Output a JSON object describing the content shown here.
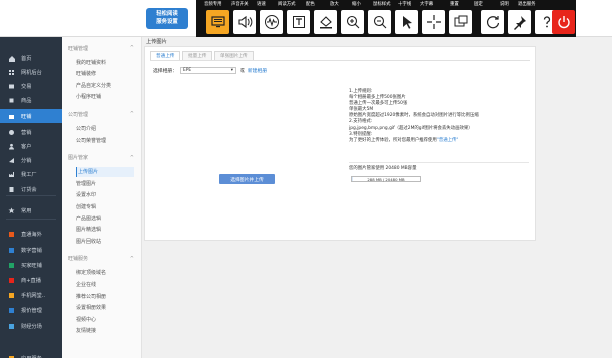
{
  "toolbar": {
    "brand": {
      "line1": "轻松阅读",
      "line2": "服务设置"
    },
    "labels": [
      "音频专用",
      "声音开关",
      "语速",
      "阅读方式",
      "配色",
      "放大",
      "缩小",
      "鼠标样式",
      "十字线",
      "大字幕",
      "重置",
      "固定",
      "说明",
      "退出服务"
    ],
    "buttons": [
      {
        "name": "screen-reader-button",
        "icon": "monitor-icon"
      },
      {
        "name": "sound-toggle-button",
        "icon": "speaker-icon"
      },
      {
        "name": "speed-button",
        "icon": "waveform-icon"
      },
      {
        "name": "read-mode-button",
        "icon": "read-mode-icon"
      },
      {
        "name": "color-scheme-button",
        "icon": "paint-bucket-icon"
      },
      {
        "name": "zoom-in-button",
        "icon": "zoom-in-icon"
      },
      {
        "name": "zoom-out-button",
        "icon": "zoom-out-icon"
      },
      {
        "name": "cursor-style-button",
        "icon": "cursor-icon"
      },
      {
        "name": "crosshair-button",
        "icon": "crosshair-icon"
      },
      {
        "name": "large-caption-button",
        "icon": "caption-icon"
      },
      {
        "name": "reset-button",
        "icon": "reset-icon"
      },
      {
        "name": "pin-button",
        "icon": "pin-icon"
      },
      {
        "name": "help-button",
        "icon": "question-icon"
      },
      {
        "name": "exit-button",
        "icon": "power-icon"
      }
    ],
    "colors": {
      "band": "#121212",
      "accent": "#f5a623",
      "exit": "#e8251b",
      "brand": "#2e7fd0"
    }
  },
  "rail": {
    "items": [
      {
        "label": "首页",
        "icon": "home-icon"
      },
      {
        "label": "网机后台",
        "icon": "grid-icon"
      },
      {
        "label": "交易",
        "icon": "trade-icon"
      },
      {
        "label": "商品",
        "icon": "goods-icon"
      },
      {
        "label": "旺铺",
        "icon": "shop-icon",
        "active": true
      },
      {
        "label": "营销",
        "icon": "marketing-icon"
      },
      {
        "label": "客户",
        "icon": "customer-icon"
      },
      {
        "label": "分销",
        "icon": "share-icon"
      },
      {
        "label": "我工厂",
        "icon": "factory-icon"
      },
      {
        "label": "订货会",
        "icon": "order-icon"
      },
      {
        "label": "常用",
        "icon": "star-icon"
      },
      {
        "label": "直通海外",
        "icon": "globe-icon"
      },
      {
        "label": "数字营销",
        "icon": "chart-icon"
      },
      {
        "label": "买家旺铺",
        "icon": "chat-icon"
      },
      {
        "label": "商+直播",
        "icon": "live-icon"
      },
      {
        "label": "手机网堂..",
        "icon": "mobile-icon"
      },
      {
        "label": "报价管理",
        "icon": "quote-icon"
      },
      {
        "label": "财经分场",
        "icon": "finance-icon"
      },
      {
        "label": "应用服务",
        "icon": "apps-icon"
      }
    ],
    "accent": "#2f80d1"
  },
  "subnav": {
    "groups": [
      {
        "title": "旺铺管理",
        "items": [
          "我的旺铺资料",
          "旺铺装修",
          "产品自定义分类",
          "小程序旺铺"
        ]
      },
      {
        "title": "公司管理",
        "items": [
          "公司介绍",
          "公司荣誉管理"
        ]
      },
      {
        "title": "图片管家",
        "items": [
          "上传图片",
          "管理图片",
          "设置水印",
          "创建专辑",
          "产品图选辑",
          "图片精选辑",
          "图片回收站"
        ]
      },
      {
        "title": "旺铺服务",
        "items": [
          "绑定顶级域名",
          "企业在线",
          "推荐公司相册",
          "设置相册效果",
          "视频中心",
          "友情链接"
        ]
      }
    ],
    "active_item": "上传图片"
  },
  "main": {
    "breadcrumb": "上传图片",
    "tabs": [
      {
        "label": "普通上传",
        "active": true
      },
      {
        "label": "批量上传",
        "active": false
      },
      {
        "label": "单张图片上传",
        "active": false
      }
    ],
    "group_label": "选择相册：",
    "group_value": "EPE",
    "or_label": "或",
    "new_album": "新建相册",
    "upload_button": "选择图片并上传",
    "help": {
      "h1": "1.上传规则:",
      "l1": "每个相册最多上传500张图片",
      "l2": "普通上传一次最多可上传50张",
      "l3": "单张最大5M",
      "l4": "原始图片宽度超过1920像素时，系统会自动对图片进行等比例压缩",
      "h2": "2.支持格式:",
      "l5": "jpg,jpeg,bmp,png,gif（超过2M的gif图片将会丢失动画效果）",
      "h3": "3.特别提醒:",
      "l6_pre": "为了更好的上传体验，所对您最用户推荐使用",
      "l6_link": "\"普通上传\""
    },
    "quota_label": "您的图片管家使用 20480 MB容量",
    "quota_value": "288 MB / 20480 MB",
    "quota_fraction": 0.014
  }
}
